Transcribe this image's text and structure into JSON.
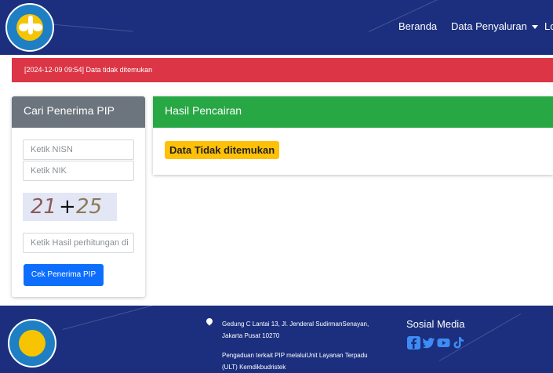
{
  "navbar": {
    "links": [
      "Beranda",
      "Data Penyaluran",
      "Lo"
    ],
    "logo_text": "TUT WURI HANDAYANI"
  },
  "alert": {
    "text": "[2024-12-09 09:54] Data tidak ditemukan",
    "color": "#dc3545"
  },
  "search_card": {
    "title": "Cari Penerima PIP",
    "nisn_placeholder": "Ketik NISN",
    "nik_placeholder": "Ketik NIK",
    "captcha": {
      "left": "21",
      "op": "+",
      "right": "25"
    },
    "result_placeholder": "Ketik Hasil perhitungan di",
    "submit_label": "Cek Penerima PIP"
  },
  "result_card": {
    "title": "Hasil Pencairan",
    "message": "Data Tidak ditemukan"
  },
  "footer": {
    "address": "Gedung C Lantai 13, Jl. Jenderal SudirmanSenayan, Jakarta Pusat 10270",
    "complaint": "Pengaduan terkait PIP melaluiUnit Layanan Terpadu (ULT) Kemdikbudristek",
    "social_title": "Sosial Media",
    "social_icons": [
      "facebook-icon",
      "twitter-icon",
      "youtube-icon",
      "tiktok-icon"
    ]
  },
  "colors": {
    "navy": "#1b2f7e",
    "green": "#28a745",
    "gray": "#6c757d",
    "blue": "#0d6efd",
    "yellow": "#ffc107"
  }
}
